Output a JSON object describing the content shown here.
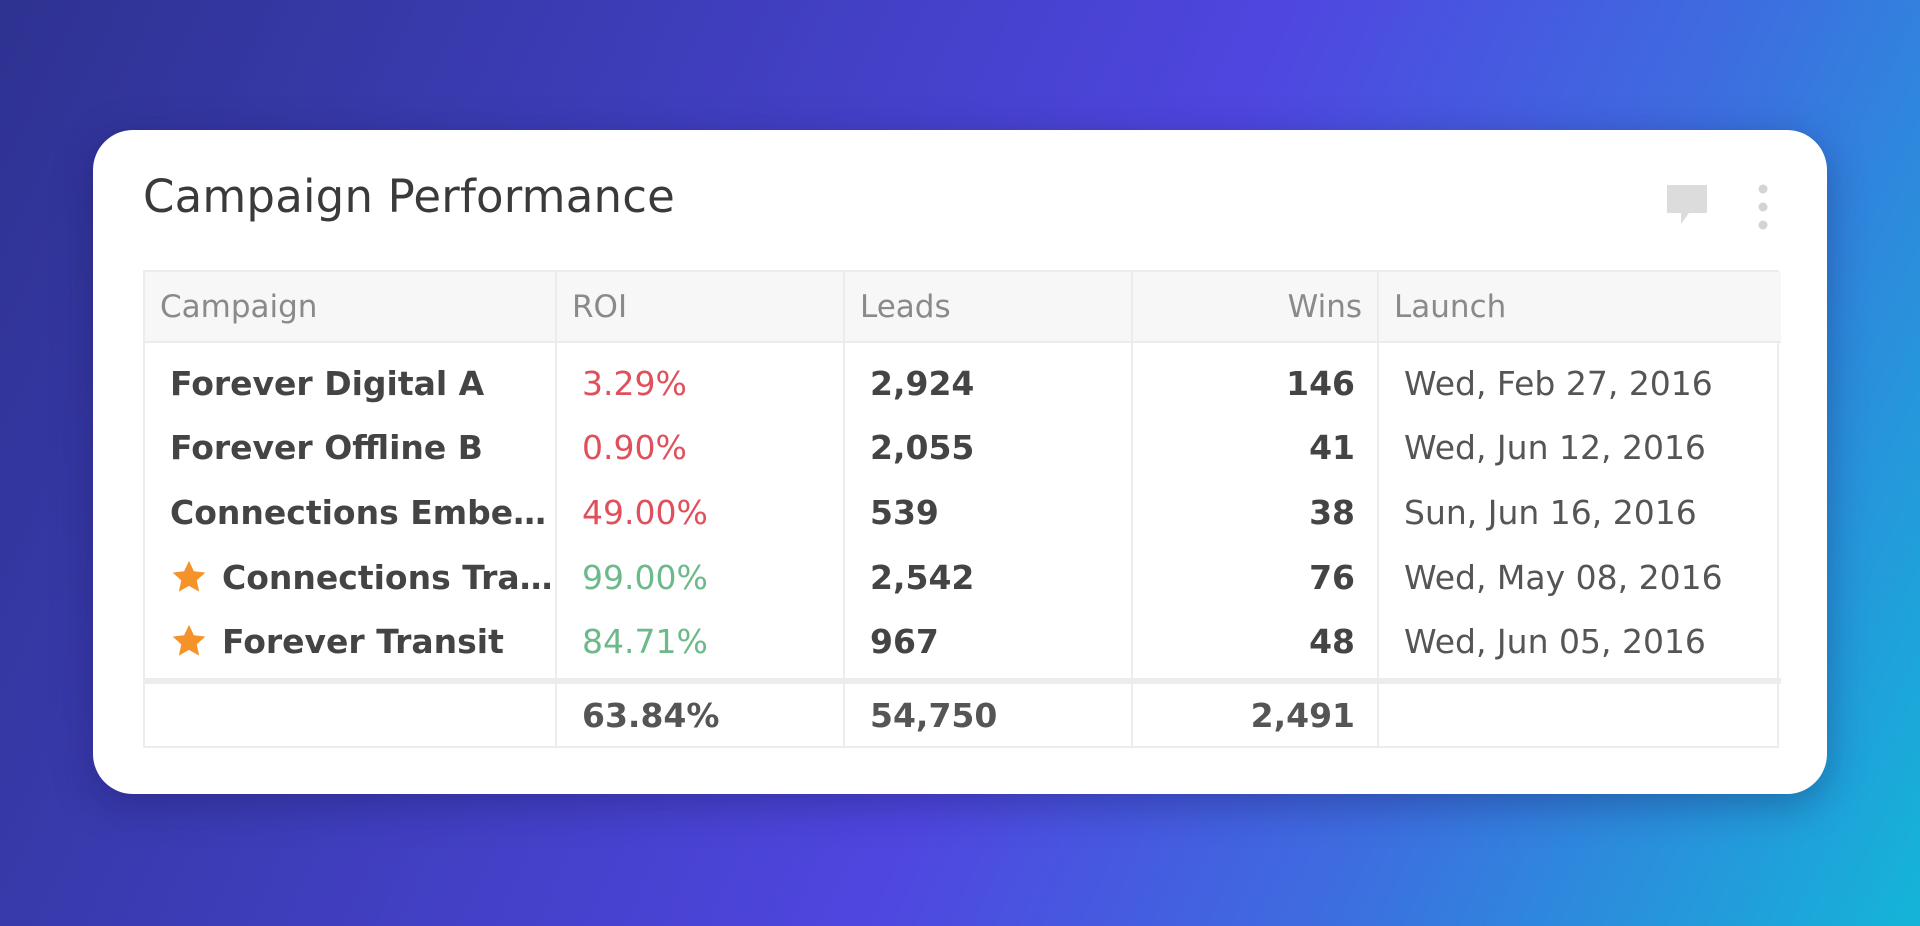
{
  "widget": {
    "title": "Campaign Performance",
    "icons": {
      "comment": "comment-icon",
      "more": "more-vertical-icon",
      "favorite": "star-icon"
    },
    "colors": {
      "negative": "#e0505c",
      "positive": "#6cb98a",
      "star": "#f5922a"
    }
  },
  "table": {
    "headers": {
      "campaign": "Campaign",
      "roi": "ROI",
      "leads": "Leads",
      "wins": "Wins",
      "launch": "Launch"
    },
    "rows": [
      {
        "campaign": "Forever Digital A",
        "roi": "3.29%",
        "roi_status": "negative",
        "leads": "2,924",
        "wins": "146",
        "launch": "Wed, Feb 27, 2016",
        "starred": false
      },
      {
        "campaign": "Forever Offline B",
        "roi": "0.90%",
        "roi_status": "negative",
        "leads": "2,055",
        "wins": "41",
        "launch": "Wed, Jun 12, 2016",
        "starred": false
      },
      {
        "campaign": "Connections Embed...",
        "roi": "49.00%",
        "roi_status": "negative",
        "leads": "539",
        "wins": "38",
        "launch": "Sun, Jun 16, 2016",
        "starred": false
      },
      {
        "campaign": "Connections Tra...",
        "roi": "99.00%",
        "roi_status": "positive",
        "leads": "2,542",
        "wins": "76",
        "launch": "Wed, May 08, 2016",
        "starred": true
      },
      {
        "campaign": "Forever Transit",
        "roi": "84.71%",
        "roi_status": "positive",
        "leads": "967",
        "wins": "48",
        "launch": "Wed, Jun 05, 2016",
        "starred": true
      }
    ],
    "totals": {
      "campaign": "",
      "roi": "63.84%",
      "leads": "54,750",
      "wins": "2,491",
      "launch": ""
    }
  }
}
